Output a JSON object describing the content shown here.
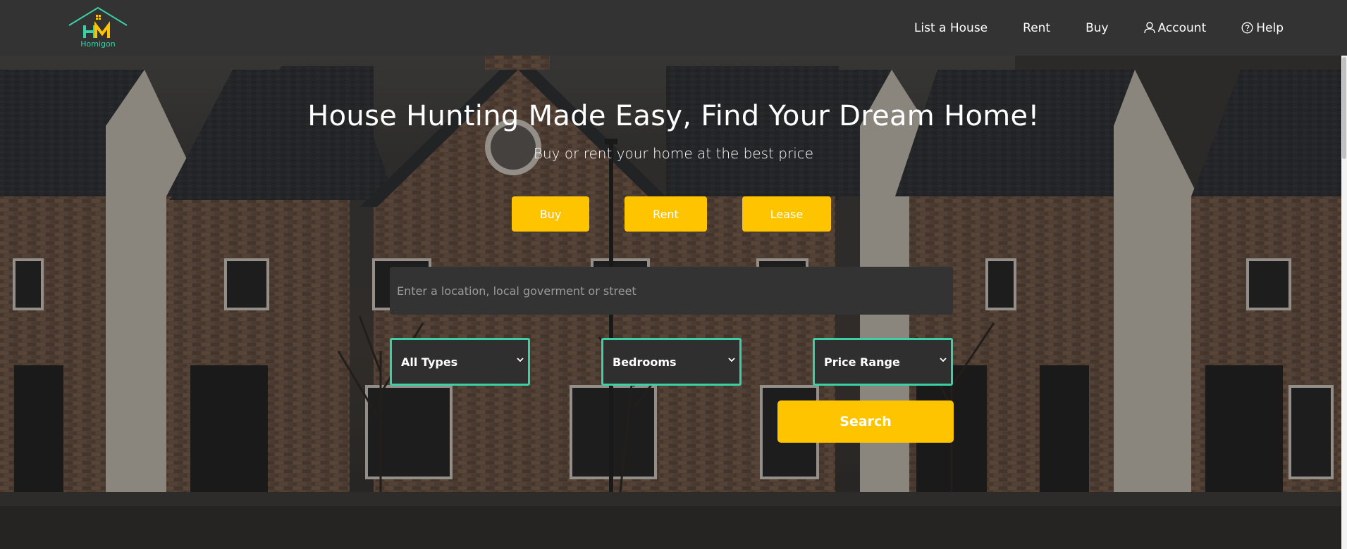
{
  "brand": {
    "name": "Homigon",
    "logo_letters": "HM"
  },
  "nav": {
    "items": [
      {
        "label": "List a House",
        "icon": ""
      },
      {
        "label": "Rent",
        "icon": ""
      },
      {
        "label": "Buy",
        "icon": ""
      },
      {
        "label": "Account",
        "icon": "user-icon"
      },
      {
        "label": "Help",
        "icon": "help-circle-icon"
      }
    ]
  },
  "hero": {
    "title": "House Hunting Made Easy, Find Your Dream Home!",
    "subtitle": "Buy or rent your home at the best price",
    "modes": [
      "Buy",
      "Rent",
      "Lease"
    ],
    "search_placeholder": "Enter a location, local goverment or street",
    "filters": {
      "type": "All Types",
      "bedrooms": "Bedrooms",
      "price": "Price Range"
    },
    "search_label": "Search"
  },
  "colors": {
    "accent_yellow": "#ffc400",
    "accent_teal": "#3bd1a6",
    "header_bg": "#333333"
  }
}
